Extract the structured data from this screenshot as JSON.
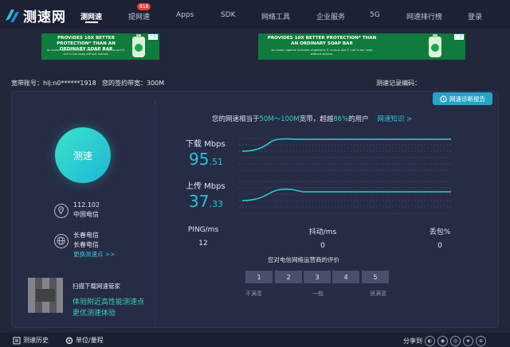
{
  "brand": {
    "name": "测速网"
  },
  "nav": {
    "items": [
      "测网速",
      "提网速",
      "Apps",
      "SDK",
      "网络工具",
      "企业服务",
      "5G",
      "网速排行榜",
      "登录"
    ],
    "badge": "818"
  },
  "ads": [
    {
      "headline": "PROVIDES 10X BETTER PROTECTION* THAN AN ORDINARY SOAP BAR",
      "fine_print": "As shown against indicator organisms S. aureus and E. coli in bar soap without actives.",
      "close_label": "广告"
    },
    {
      "headline": "PROVIDES 10X BETTER PROTECTION* THAN AN ORDINARY SOAP BAR",
      "fine_print": "As shown against indicator organisms S. aureus and E. coli in bar soap without actives.",
      "close_label": "广告"
    }
  ],
  "account": {
    "account_label": "宽带账号：hlj:n0******1918",
    "bandwidth_label": "您的签约带宽：300M",
    "record_label": "测速记录编码："
  },
  "diagnose_button": "网速诊断报告",
  "start_button": "测速",
  "ip_info": {
    "ip": "112.102",
    "isp": "中国电信"
  },
  "server_info": {
    "line1": "长春电信",
    "line2": "长春电信",
    "change_link": "更换测速点 >>"
  },
  "summary": {
    "prefix": "您的网速相当于",
    "range": "50M～100M",
    "mid": "宽带，超越",
    "percent": "86%",
    "suffix": "的用户",
    "knowledge_link": "网速知识 >"
  },
  "download": {
    "label": "下载 Mbps",
    "int": "95",
    "dec": ".51"
  },
  "upload": {
    "label": "上传 Mbps",
    "int": "37",
    "dec": ".33"
  },
  "stats": [
    {
      "label": "PING/ms",
      "value": "12"
    },
    {
      "label": "抖动/ms",
      "value": "0"
    },
    {
      "label": "丢包%",
      "value": "0"
    }
  ],
  "rating": {
    "title": "您对电信网络运营商的评价",
    "options": [
      "1",
      "2",
      "3",
      "4",
      "5"
    ],
    "low": "不满意",
    "mid": "一般",
    "high": "很满意"
  },
  "promo": {
    "line1": "扫描下载网速管家",
    "line2": "体验附近高性能测速点",
    "line3": "更优测速体验"
  },
  "footer": {
    "history": "测速历史",
    "units": "单位/量程",
    "share": "分享到"
  },
  "colors": {
    "accent": "#28c1e3",
    "highlight": "#36d0c0",
    "background": "#22273b"
  }
}
